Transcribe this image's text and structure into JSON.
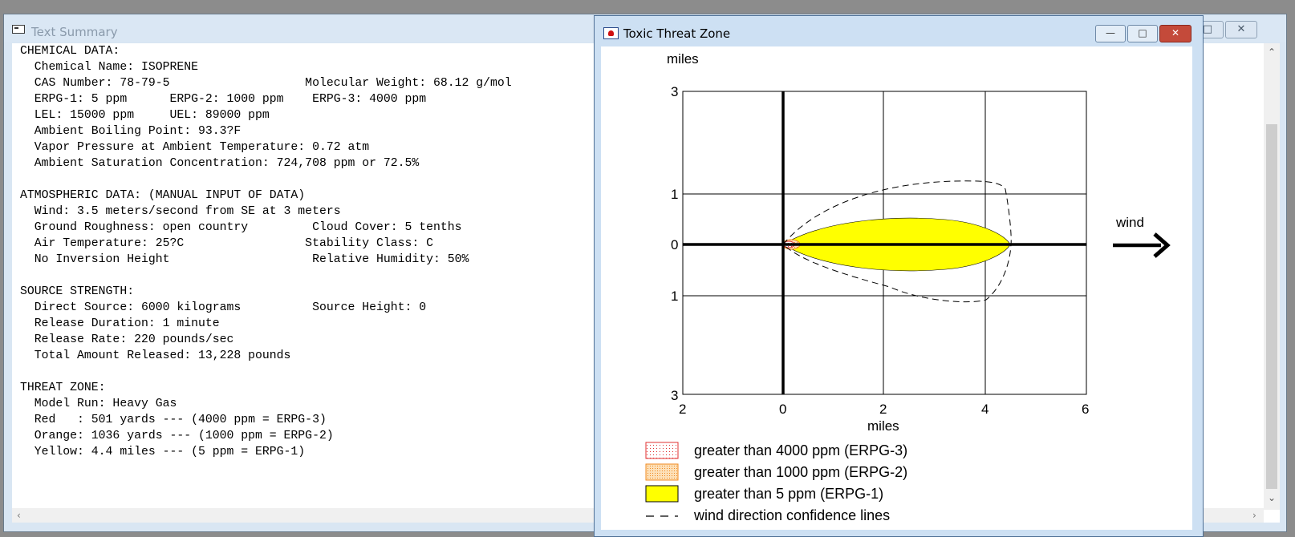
{
  "text_summary": {
    "title": "Text Summary",
    "lines": [
      "CHEMICAL DATA:",
      "  Chemical Name: ISOPRENE",
      "  CAS Number: 78-79-5                   Molecular Weight: 68.12 g/mol",
      "  ERPG-1: 5 ppm      ERPG-2: 1000 ppm    ERPG-3: 4000 ppm",
      "  LEL: 15000 ppm     UEL: 89000 ppm",
      "  Ambient Boiling Point: 93.3?F",
      "  Vapor Pressure at Ambient Temperature: 0.72 atm",
      "  Ambient Saturation Concentration: 724,708 ppm or 72.5%",
      "",
      "ATMOSPHERIC DATA: (MANUAL INPUT OF DATA)",
      "  Wind: 3.5 meters/second from SE at 3 meters",
      "  Ground Roughness: open country         Cloud Cover: 5 tenths",
      "  Air Temperature: 25?C                 Stability Class: C",
      "  No Inversion Height                    Relative Humidity: 50%",
      "",
      "SOURCE STRENGTH:",
      "  Direct Source: 6000 kilograms          Source Height: 0",
      "  Release Duration: 1 minute",
      "  Release Rate: 220 pounds/sec",
      "  Total Amount Released: 13,228 pounds",
      "",
      "THREAT ZONE:",
      "  Model Run: Heavy Gas",
      "  Red   : 501 yards --- (4000 ppm = ERPG-3)",
      "  Orange: 1036 yards --- (1000 ppm = ERPG-2)",
      "  Yellow: 4.4 miles --- (5 ppm = ERPG-1)"
    ]
  },
  "threat_zone": {
    "title": "Toxic Threat Zone",
    "y_unit": "miles",
    "x_unit": "miles",
    "y_ticks": [
      "3",
      "1",
      "0",
      "1",
      "3"
    ],
    "x_ticks": [
      "2",
      "0",
      "2",
      "4",
      "6"
    ],
    "wind_label": "wind",
    "legend": [
      {
        "label": "greater than 4000 ppm (ERPG-3)"
      },
      {
        "label": "greater than 1000 ppm (ERPG-2)"
      },
      {
        "label": "greater than 5 ppm (ERPG-1)"
      },
      {
        "label": "wind direction confidence lines"
      }
    ],
    "colors": {
      "erpg3": "#e03030",
      "erpg2": "#f4a040",
      "erpg1": "#ffff00",
      "grid": "#000000"
    }
  }
}
